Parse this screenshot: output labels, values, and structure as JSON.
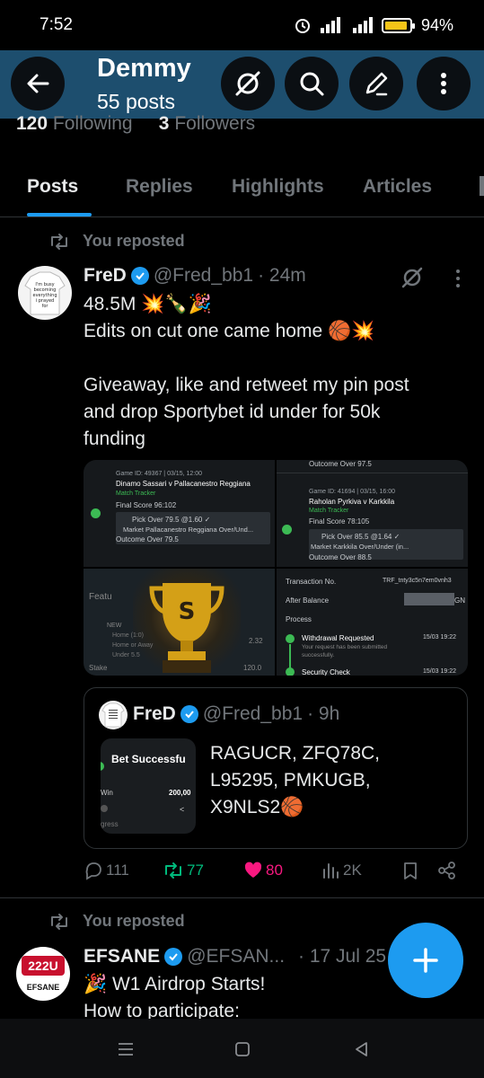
{
  "status": {
    "time": "7:52",
    "battery": "94%",
    "battery_level": 0.94
  },
  "header": {
    "title": "Demmy",
    "post_count": "55 posts"
  },
  "profile": {
    "following_count": "120",
    "following_label": "Following",
    "followers_count": "3",
    "followers_label": "Followers"
  },
  "tabs": [
    {
      "label": "Posts",
      "active": true
    },
    {
      "label": "Replies",
      "active": false
    },
    {
      "label": "Highlights",
      "active": false
    },
    {
      "label": "Articles",
      "active": false
    }
  ],
  "posts": [
    {
      "repost_label": "You reposted",
      "author": "FreD",
      "handle": "@Fred_bb1",
      "time": "· 24m",
      "text_lines": [
        "48.5M 💥🍾🎉",
        "Edits on cut one came home 🏀💥",
        "",
        "Giveaway, like and retweet my pin post",
        "and drop Sportybet id under for 50k",
        "funding"
      ],
      "media": {
        "bet1": {
          "game_id": "Game ID: 49367 | 03/15, 12:00",
          "teams": "Dinamo Sassari v Pallacanestro Reggiana",
          "tracker": "Match Tracker",
          "final_score": "Final Score  96:102",
          "pick": "Pick  Over 79.5 @1.60 ✓",
          "market": "Market  Pallacanestro Reggiana Over/Und...",
          "outcome": "Outcome  Over 79.5"
        },
        "bet2": {
          "outcome_top": "Outcome  Over 97.5",
          "game_id": "Game ID: 41694 | 03/15, 16:00",
          "teams": "Raholan Pyrkiva v Karkkila",
          "tracker": "Match Tracker",
          "final_score": "Final Score  78:105",
          "pick": "Pick  Over 85.5 @1.64 ✓",
          "market": "Market  Karkkila Over/Under (in...",
          "outcome": "Outcome  Over 88.5"
        },
        "trophy": {
          "feature_text": "Featu",
          "rows": [
            "NEW",
            "Home (1:0)",
            "Home or Away",
            "Under 5.5"
          ],
          "odd": "2.32",
          "stake_label": "Stake",
          "stake_value": "120.0",
          "badge": "S"
        },
        "transaction": {
          "tx_label": "Transaction No.",
          "tx_value": "TRF_tnty3c5n7em0vnh3",
          "balance_label": "After Balance",
          "balance_suffix": "GN",
          "process_label": "Process",
          "withdrawal": "Withdrawal Requested",
          "withdrawal_note": "Your request has been submitted",
          "withdrawal_note2": "successfully.",
          "withdrawal_date": "15/03 19:22",
          "security": "Security Check",
          "security_date": "15/03 19:22"
        }
      },
      "quote": {
        "author": "FreD",
        "handle": "@Fred_bb1",
        "time": "· 9h",
        "thumb_title": "Bet Successfu",
        "thumb_win": "Win",
        "thumb_amount": "200,00",
        "thumb_footer": "gress",
        "text_lines": [
          "RAGUCR, ZFQ78C,",
          "L95295, PMKUGB,",
          "X9NLS2🏀"
        ]
      },
      "stats": {
        "replies": "111",
        "reposts": "77",
        "likes": "80",
        "views": "2K"
      }
    },
    {
      "repost_label": "You reposted",
      "author": "EFSANE",
      "handle": "@EFSAN...",
      "time": "· 17 Jul 25",
      "avatar_text": "222U",
      "avatar_sub": "EFSANE",
      "text_lines": [
        "🎉 W1 Airdrop Starts!",
        "How to participate:"
      ]
    }
  ],
  "avatar_shirt_text": [
    "I'm busy",
    "becoming",
    "everything",
    "i prayed",
    "for"
  ],
  "colors": {
    "accent": "#1d9bf0",
    "header_bg": "#1d4e6e",
    "retweet_green": "#00ba7c",
    "like_pink": "#f91880"
  }
}
